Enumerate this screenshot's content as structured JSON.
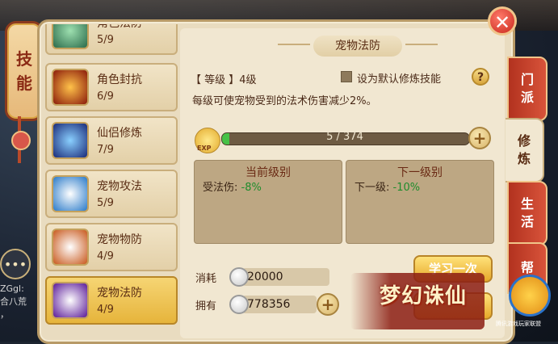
{
  "side_tab": {
    "chars": [
      "技",
      "能"
    ]
  },
  "chat": {
    "lines": [
      "ZGgl:",
      "合八荒",
      "，"
    ]
  },
  "skills": [
    {
      "name": "角色法防",
      "level": "5/9",
      "color": "#4a9a6a"
    },
    {
      "name": "角色封抗",
      "level": "6/9",
      "color": "#c8381c"
    },
    {
      "name": "仙侣修炼",
      "level": "7/9",
      "color": "#2a4aa8"
    },
    {
      "name": "宠物攻法",
      "level": "5/9",
      "color": "#2a6aa8"
    },
    {
      "name": "宠物物防",
      "level": "4/9",
      "color": "#d8681c"
    },
    {
      "name": "宠物法防",
      "level": "4/9",
      "color": "#6a2aa8",
      "selected": true
    }
  ],
  "tabs": [
    {
      "chars": [
        "门",
        "派"
      ]
    },
    {
      "chars": [
        "修",
        "炼"
      ],
      "active": true
    },
    {
      "chars": [
        "生",
        "活"
      ]
    },
    {
      "chars": [
        "帮"
      ]
    }
  ],
  "detail": {
    "title": "宠物法防",
    "level_label": "【 等级 】4级",
    "default_checkbox_label": "设为默认修炼技能",
    "help": "?",
    "description": "每级可使宠物受到的法术伤害减少2%。",
    "exp_icon_label": "EXP",
    "exp_text": "5 / 374",
    "exp_progress": 0.0134,
    "current": {
      "title": "当前级别",
      "label": "受法伤:",
      "value": "-8%"
    },
    "next": {
      "title": "下一级别",
      "label": "下一级:",
      "value": "-10%"
    },
    "cost_label": "消耗",
    "cost_value": "20000",
    "own_label": "拥有",
    "own_value": "778356",
    "learn_once": "学习一次"
  },
  "watermark": {
    "title": "梦幻诛仙",
    "caption": "腾讯游戏玩家联盟"
  },
  "colors": {
    "accent_red": "#c8281c",
    "gold": "#e6b43b",
    "value_green": "#1e8c2c"
  }
}
